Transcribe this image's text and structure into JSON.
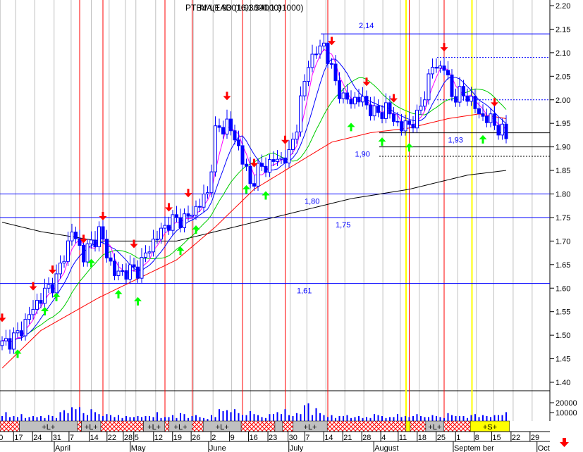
{
  "chart_data": {
    "type": "candlestick",
    "title_overlays": [
      "PTBV LEAD (1.93000,1.91000)",
      "MA(1.93016,1.94000)"
    ],
    "ylim": [
      1.4,
      2.2
    ],
    "yticks": [
      "2.20",
      "2.15",
      "2.10",
      "2.05",
      "2.00",
      "1.95",
      "1.90",
      "1.85",
      "1.80",
      "1.75",
      "1.70",
      "1.65",
      "1.60",
      "1.55",
      "1.50",
      "1.45",
      "1.40"
    ],
    "volume_ticks": [
      "20000",
      "10000"
    ],
    "days": 131,
    "price_anchors": [
      [
        0,
        1.48
      ],
      [
        4,
        1.5
      ],
      [
        9,
        1.57
      ],
      [
        14,
        1.62
      ],
      [
        18,
        1.72
      ],
      [
        21,
        1.67
      ],
      [
        25,
        1.72
      ],
      [
        29,
        1.63
      ],
      [
        35,
        1.64
      ],
      [
        39,
        1.7
      ],
      [
        43,
        1.74
      ],
      [
        48,
        1.75
      ],
      [
        53,
        1.8
      ],
      [
        55,
        1.93
      ],
      [
        58,
        1.95
      ],
      [
        61,
        1.9
      ],
      [
        64,
        1.82
      ],
      [
        66,
        1.85
      ],
      [
        70,
        1.87
      ],
      [
        74,
        1.88
      ],
      [
        76,
        1.95
      ],
      [
        79,
        2.08
      ],
      [
        83,
        2.12
      ],
      [
        85,
        2.06
      ],
      [
        88,
        2.0
      ],
      [
        93,
        2.0
      ],
      [
        96,
        1.97
      ],
      [
        99,
        1.98
      ],
      [
        103,
        1.94
      ],
      [
        107,
        1.96
      ],
      [
        111,
        2.07
      ],
      [
        114,
        2.07
      ],
      [
        116,
        2.01
      ],
      [
        120,
        2.01
      ],
      [
        123,
        1.97
      ],
      [
        127,
        1.95
      ],
      [
        130,
        1.92
      ]
    ],
    "long_ma_anchors": [
      [
        0,
        1.74
      ],
      [
        10,
        1.72
      ],
      [
        25,
        1.7
      ],
      [
        45,
        1.7
      ],
      [
        60,
        1.73
      ],
      [
        75,
        1.76
      ],
      [
        90,
        1.79
      ],
      [
        105,
        1.81
      ],
      [
        120,
        1.84
      ],
      [
        130,
        1.85
      ]
    ],
    "mid_ma_anchors": [
      [
        0,
        1.43
      ],
      [
        10,
        1.51
      ],
      [
        25,
        1.58
      ],
      [
        35,
        1.62
      ],
      [
        45,
        1.66
      ],
      [
        55,
        1.73
      ],
      [
        65,
        1.81
      ],
      [
        75,
        1.86
      ],
      [
        85,
        1.91
      ],
      [
        95,
        1.93
      ],
      [
        105,
        1.94
      ],
      [
        115,
        1.96
      ],
      [
        123,
        1.97
      ],
      [
        130,
        1.96
      ]
    ],
    "volume": [
      5,
      9,
      4,
      5,
      4,
      7,
      3,
      4,
      5,
      4,
      5,
      3,
      6,
      5,
      3,
      9,
      11,
      8,
      14,
      12,
      14,
      8,
      6,
      12,
      9,
      7,
      5,
      7,
      6,
      4,
      6,
      3,
      5,
      4,
      4,
      5,
      4,
      5,
      5,
      4,
      9,
      3,
      4,
      4,
      6,
      3,
      8,
      7,
      3,
      5,
      6,
      4,
      3,
      2,
      6,
      4,
      12,
      10,
      11,
      9,
      12,
      8,
      6,
      6,
      10,
      7,
      6,
      4,
      3,
      7,
      7,
      9,
      7,
      12,
      6,
      5,
      8,
      7,
      16,
      18,
      6,
      13,
      8,
      6,
      4,
      6,
      3,
      5,
      5,
      6,
      3,
      4,
      5,
      3,
      4,
      3,
      7,
      6,
      5,
      3,
      4,
      4,
      7,
      4,
      5,
      4,
      5,
      7,
      5,
      4,
      4,
      6,
      5,
      4,
      3,
      8,
      6,
      5,
      5,
      5,
      3,
      6,
      7,
      4,
      6,
      5,
      4,
      6,
      6,
      6,
      9
    ],
    "sell_arrows": [
      0,
      8,
      13,
      21,
      26,
      34,
      43,
      48,
      58,
      65,
      73,
      85,
      94,
      101,
      114,
      127
    ],
    "buy_arrows": [
      4,
      11,
      14,
      23,
      30,
      35,
      46,
      50,
      63,
      68,
      90,
      98,
      105,
      124
    ],
    "signal_lines_red": [
      20,
      26,
      42,
      49,
      62,
      73,
      84,
      105,
      114
    ],
    "signal_lines_yellow": [
      104,
      121
    ],
    "levels": [
      {
        "value": 2.14,
        "label": "2,14",
        "style": "solid",
        "color": "#0000ff",
        "label_day": 92
      },
      {
        "value": 1.8,
        "label": "1,80",
        "style": "solid",
        "color": "#0000ff",
        "label_day": 78
      },
      {
        "value": 1.75,
        "label": "1,75",
        "style": "solid",
        "color": "#0000ff",
        "label_day": 86
      },
      {
        "value": 1.61,
        "label": "1,61",
        "style": "solid",
        "color": "#0000ff",
        "label_day": 76
      },
      {
        "value": 1.93,
        "label": "1,93",
        "style": "solid",
        "color": "#000000",
        "label_day": 115
      },
      {
        "value": 1.9,
        "label": "1,90",
        "style": "solid",
        "color": "#000000",
        "label_day": 91
      },
      {
        "value": 2.09,
        "label": "",
        "style": "dotted",
        "color": "#0000ff",
        "label_day": 0
      },
      {
        "value": 2.0,
        "label": "",
        "style": "dotted",
        "color": "#0000ff",
        "label_day": 0
      },
      {
        "value": 1.88,
        "label": "",
        "style": "dotted",
        "color": "#000000",
        "label_day": 0
      }
    ],
    "bands": [
      {
        "from": 0,
        "to": 5,
        "type": "hatch",
        "label": ""
      },
      {
        "from": 5,
        "to": 20,
        "type": "long",
        "label": "+L+"
      },
      {
        "from": 20,
        "to": 21,
        "type": "hatch",
        "label": ""
      },
      {
        "from": 21,
        "to": 26,
        "type": "long",
        "label": "+L+"
      },
      {
        "from": 26,
        "to": 37,
        "type": "hatch",
        "label": ""
      },
      {
        "from": 37,
        "to": 42.5,
        "type": "long",
        "label": "+L+"
      },
      {
        "from": 42.5,
        "to": 43.6,
        "type": "hatch",
        "label": ""
      },
      {
        "from": 43.6,
        "to": 49.5,
        "type": "long",
        "label": "+L+"
      },
      {
        "from": 49.5,
        "to": 52.4,
        "type": "hatch",
        "label": ""
      },
      {
        "from": 52.4,
        "to": 62.2,
        "type": "long",
        "label": "+L+"
      },
      {
        "from": 62.2,
        "to": 70.9,
        "type": "hatch",
        "label": ""
      },
      {
        "from": 70.9,
        "to": 72.9,
        "type": "long",
        "label": ""
      },
      {
        "from": 72.9,
        "to": 75.6,
        "type": "hatch",
        "label": ""
      },
      {
        "from": 75.6,
        "to": 84.4,
        "type": "long",
        "label": "+L+"
      },
      {
        "from": 84.4,
        "to": 104.7,
        "type": "hatch",
        "label": ""
      },
      {
        "from": 104.7,
        "to": 105.8,
        "type": "yellow",
        "label": ""
      },
      {
        "from": 105.8,
        "to": 109.8,
        "type": "hatch",
        "label": ""
      },
      {
        "from": 109.8,
        "to": 114.5,
        "type": "long",
        "label": "+L+"
      },
      {
        "from": 114.5,
        "to": 121.3,
        "type": "hatch",
        "label": ""
      },
      {
        "from": 121.3,
        "to": 131.4,
        "type": "short",
        "label": "+S+"
      }
    ],
    "date_ticks": [
      {
        "l": "0",
        "d": -0.5
      },
      {
        "l": "17",
        "d": 3.5
      },
      {
        "l": "24",
        "d": 8.4
      },
      {
        "l": "31",
        "d": 13.4
      },
      {
        "l": "7",
        "d": 17.8
      },
      {
        "l": "14",
        "d": 23
      },
      {
        "l": "22",
        "d": 27.6
      },
      {
        "l": "28",
        "d": 31.8
      },
      {
        "l": "5",
        "d": 34.5
      },
      {
        "l": "12",
        "d": 39.6
      },
      {
        "l": "19",
        "d": 44.5
      },
      {
        "l": "26",
        "d": 49.3
      },
      {
        "l": "2",
        "d": 54.4
      },
      {
        "l": "9",
        "d": 59.2
      },
      {
        "l": "16",
        "d": 64.1
      },
      {
        "l": "23",
        "d": 69.1
      },
      {
        "l": "30",
        "d": 74.3
      },
      {
        "l": "7",
        "d": 78.6
      },
      {
        "l": "14",
        "d": 83.5
      },
      {
        "l": "21",
        "d": 88.4
      },
      {
        "l": "28",
        "d": 93.3
      },
      {
        "l": "4",
        "d": 98.2
      },
      {
        "l": "11",
        "d": 102.7
      },
      {
        "l": "18",
        "d": 107.6
      },
      {
        "l": "25",
        "d": 112.5
      },
      {
        "l": "1",
        "d": 117.5
      },
      {
        "l": "8",
        "d": 122.3
      },
      {
        "l": "15",
        "d": 126.8
      },
      {
        "l": "22",
        "d": 131.8
      },
      {
        "l": "29",
        "d": 136.7
      }
    ],
    "months": [
      {
        "l": "April",
        "d": 14
      },
      {
        "l": "May",
        "d": 33.6
      },
      {
        "l": "June",
        "d": 53.8
      },
      {
        "l": "July",
        "d": 74.5
      },
      {
        "l": "August",
        "d": 96.4
      },
      {
        "l": "Septem ber",
        "d": 116.9
      },
      {
        "l": "Oct",
        "d": 138.5
      }
    ],
    "colors": {
      "candle": "#0000ff",
      "ma_short": "#ff00ff",
      "ma_mid1": "#0000ff",
      "ma_mid2": "#00cc00",
      "ma_mid3": "#ff0000",
      "ma_long": "#000000",
      "sell": "#ff0000",
      "buy": "#00ff00"
    }
  }
}
